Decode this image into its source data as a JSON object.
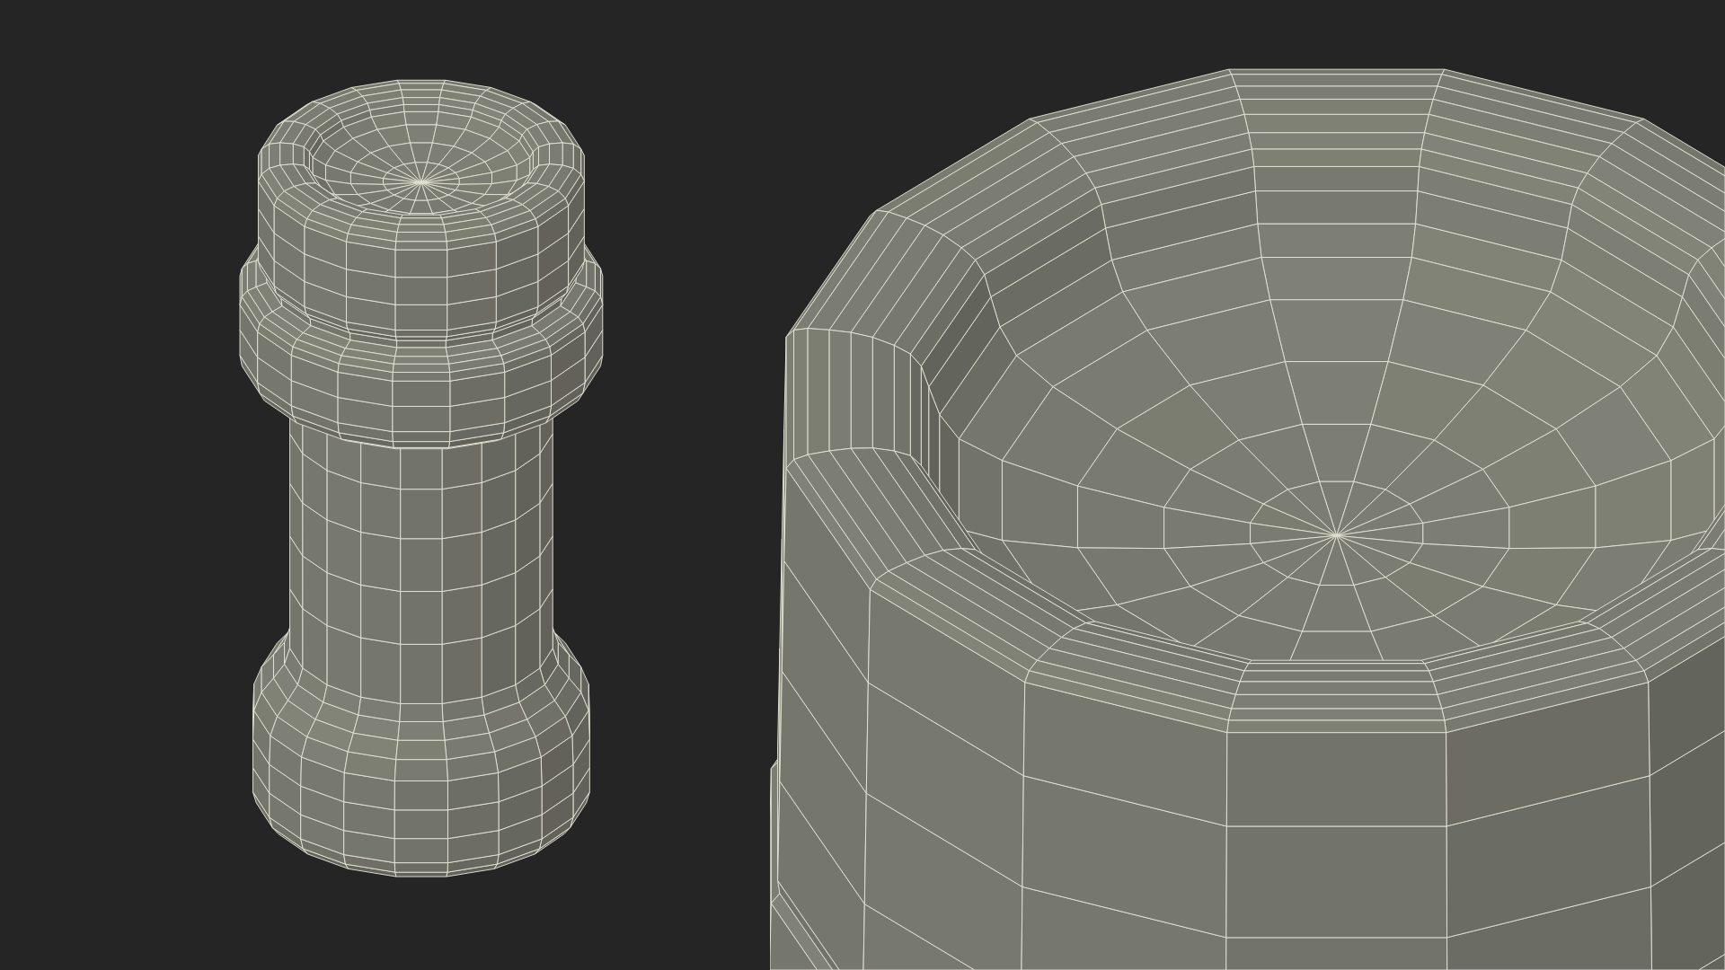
{
  "scene": {
    "models": [
      {
        "kind": "post"
      },
      {
        "kind": "bowl"
      }
    ]
  }
}
